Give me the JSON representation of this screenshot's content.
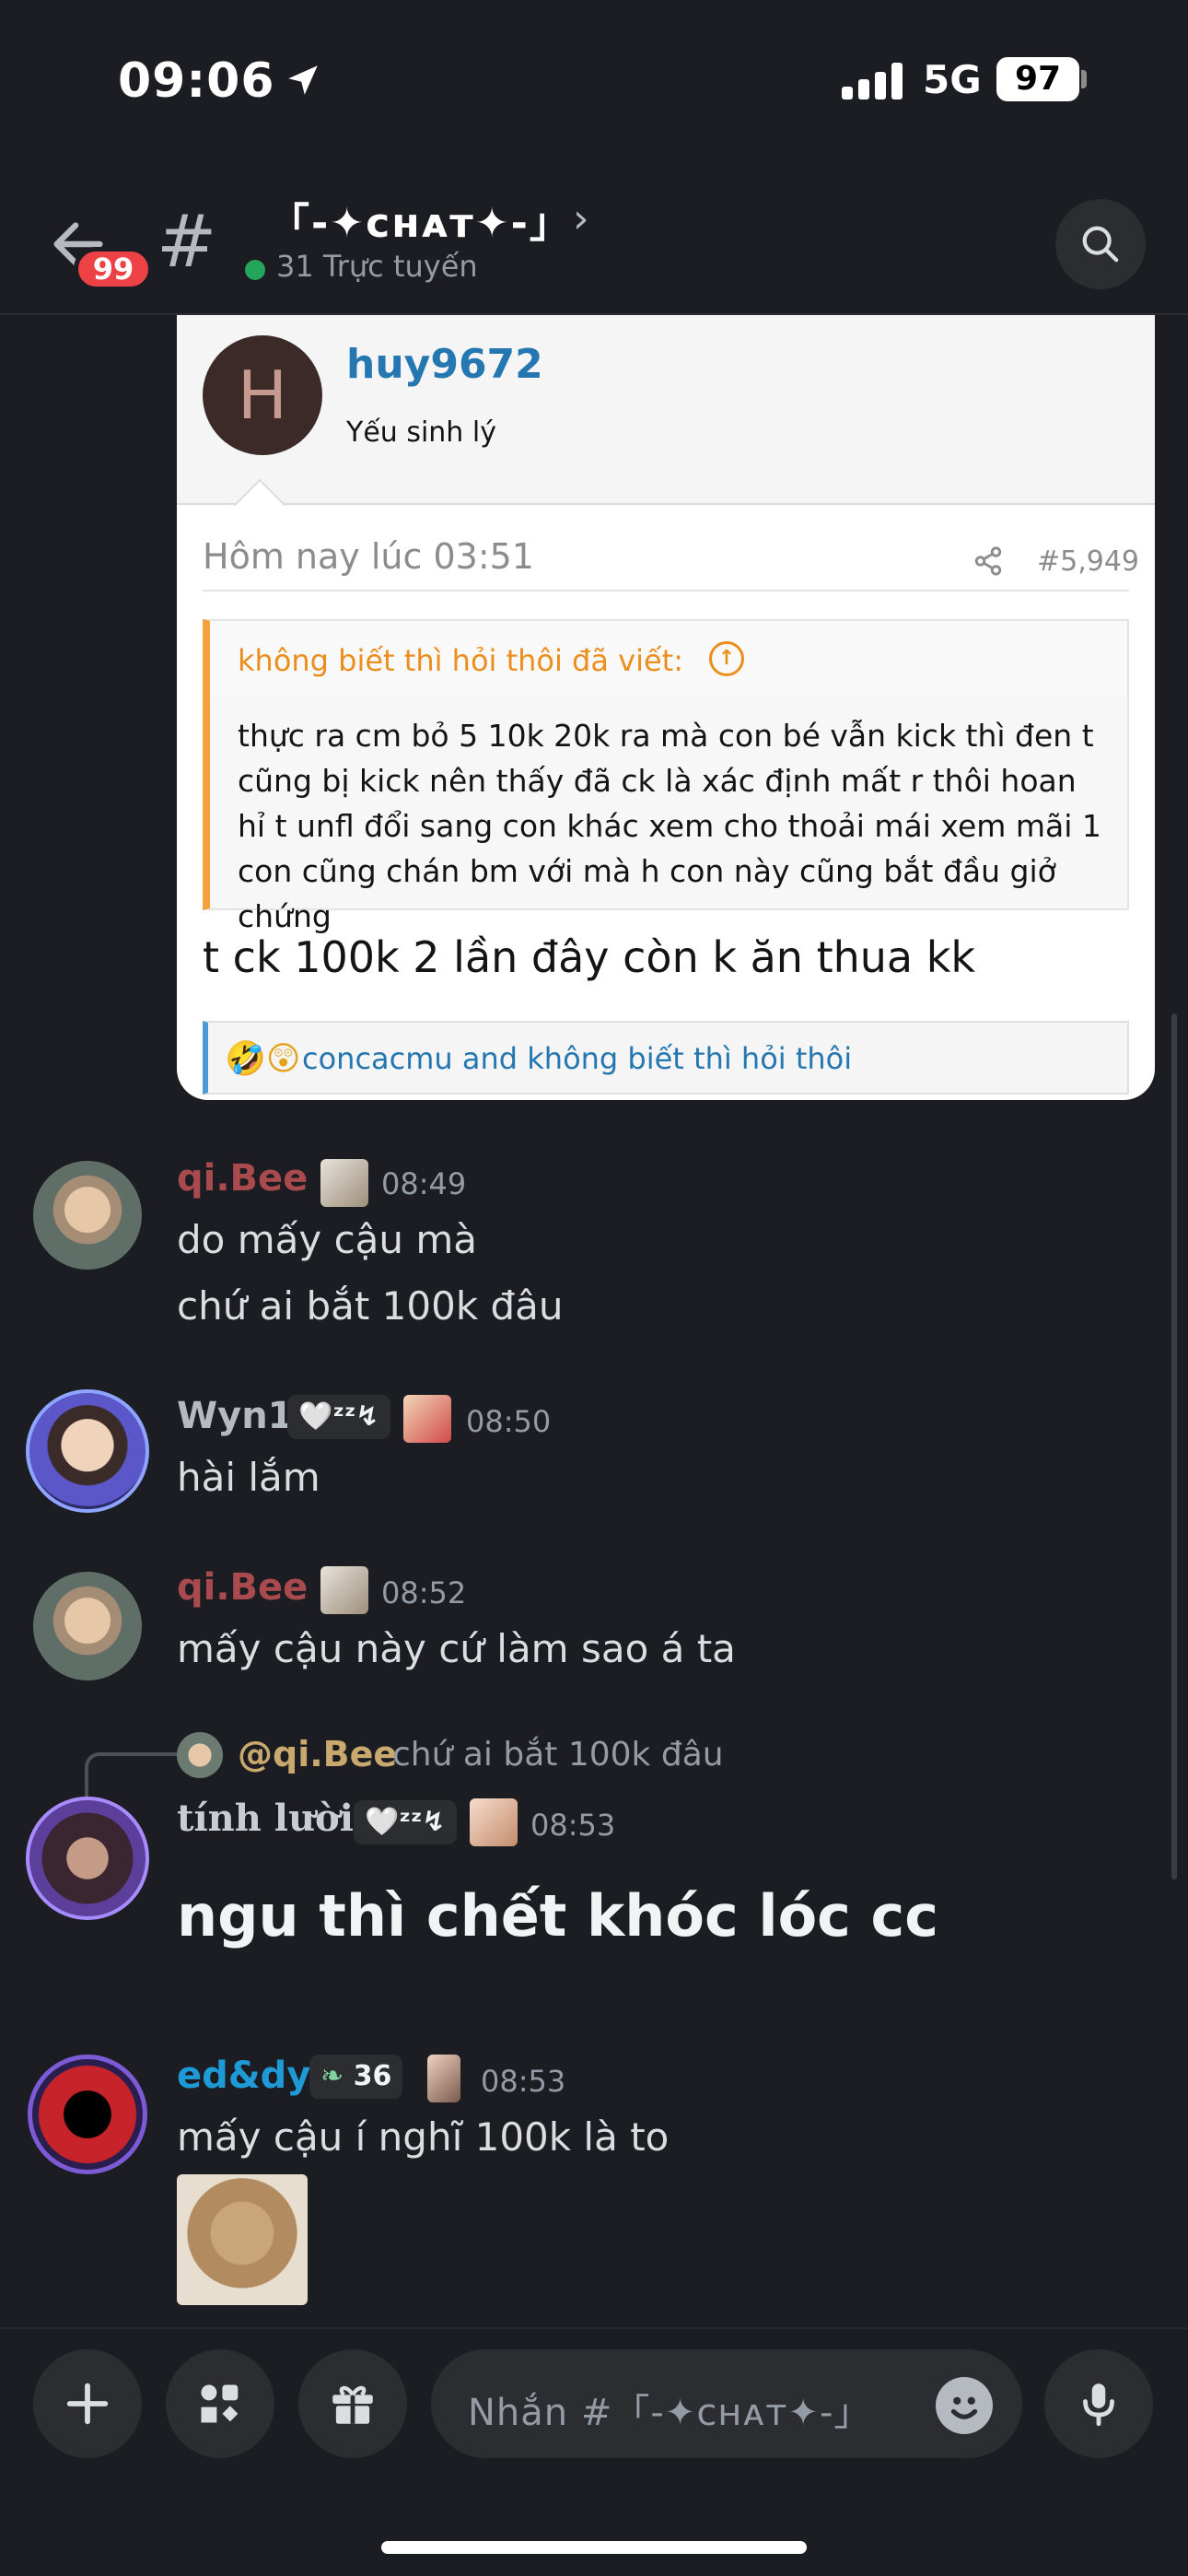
{
  "status_bar": {
    "time": "09:06",
    "network": "5G",
    "battery": "97"
  },
  "header": {
    "unread_badge": "99",
    "channel_name": "「-✦ᴄʜᴀᴛ✦-」",
    "online": "31 Trực tuyến"
  },
  "embed": {
    "avatar_letter": "H",
    "username": "huy9672",
    "user_title": "Yếu sinh lý",
    "date": "Hôm nay lúc 03:51",
    "post_number": "#5,949",
    "quote_author": "không biết thì hỏi thôi đã viết:",
    "quote_body": "thực ra cm bỏ 5 10k 20k ra mà con bé vẫn kick thì đen t cũng bị kick nên thấy đã ck là xác định mất r thôi hoan hỉ t unfl đổi sang con khác xem cho thoải mái xem mãi 1 con cũng chán bm với mà h con này cũng bắt đầu giở chứng",
    "reply": "t ck 100k 2 lần đây còn k ăn thua kk",
    "react_emojis": "🤣😲",
    "reactions": "concacmu and không biết thì hỏi thôi"
  },
  "messages": [
    {
      "user": "qi.Bee",
      "time": "08:49",
      "lines": [
        "do mấy cậu mà",
        "chứ ai bắt 100k đâu"
      ]
    },
    {
      "user": "Wyn1",
      "tag": "🤍ᶻᶻ↯",
      "time": "08:50",
      "lines": [
        "hài lắm"
      ]
    },
    {
      "user": "qi.Bee",
      "time": "08:52",
      "lines": [
        "mấy cậu này cứ làm sao á ta"
      ]
    },
    {
      "user": "tính lười",
      "tag": "🤍ᶻᶻ↯",
      "time": "08:53",
      "reply_to": "@qi.Bee",
      "reply_snippet": "chứ ai bắt 100k đâu",
      "lines": [
        "ngu thì chết khóc lóc cc"
      ]
    },
    {
      "user": "ed&dy",
      "tag": "36",
      "time": "08:53",
      "lines": [
        "mấy cậu í nghĩ 100k là to"
      ]
    }
  ],
  "composer": {
    "placeholder": "Nhắn #「-✦ᴄʜᴀᴛ✦-」"
  },
  "icons": [
    "back-arrow-icon",
    "hash-icon",
    "chevron-right-icon",
    "search-icon",
    "share-icon",
    "arrow-up-circle-icon",
    "plus-icon",
    "apps-icon",
    "gift-icon",
    "emoji-icon",
    "microphone-icon",
    "location-arrow-icon"
  ]
}
